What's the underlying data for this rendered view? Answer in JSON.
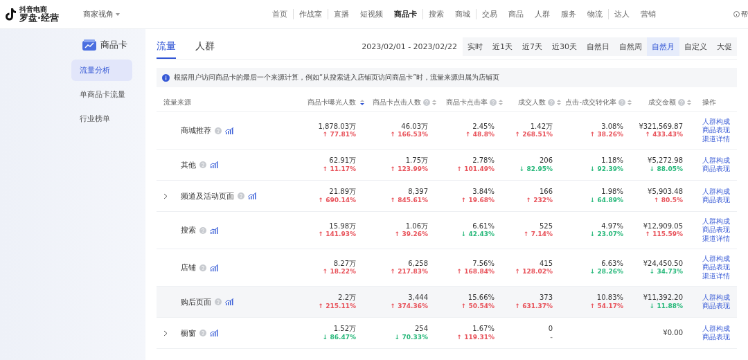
{
  "topbar": {
    "logo_small": "抖音电商",
    "logo_main": "罗盘·经营",
    "perspective": "商家视角",
    "nav": [
      {
        "label": "首页",
        "selected": false
      },
      {
        "label": "作战室",
        "selected": false
      },
      {
        "label": "直播",
        "selected": false
      },
      {
        "label": "短视频",
        "selected": false
      },
      {
        "label": "商品卡",
        "selected": true
      },
      {
        "label": "搜索",
        "selected": false
      },
      {
        "label": "商城",
        "selected": false
      },
      {
        "label": "交易",
        "selected": false
      },
      {
        "label": "商品",
        "selected": false
      },
      {
        "label": "人群",
        "selected": false
      },
      {
        "label": "服务",
        "selected": false
      },
      {
        "label": "物流",
        "selected": false
      },
      {
        "label": "达人",
        "selected": false
      },
      {
        "label": "营销",
        "selected": false
      }
    ],
    "help": "帮"
  },
  "sidebar": {
    "title": "商品卡",
    "items": [
      {
        "label": "流量分析",
        "selected": true
      },
      {
        "label": "单商品卡流量",
        "selected": false
      },
      {
        "label": "行业榜单",
        "selected": false
      }
    ]
  },
  "tabs": [
    {
      "label": "流量",
      "selected": true
    },
    {
      "label": "人群",
      "selected": false
    }
  ],
  "date_range": "2023/02/01 - 2023/02/22",
  "periods": [
    {
      "label": "实时",
      "selected": false
    },
    {
      "label": "近1天",
      "selected": false
    },
    {
      "label": "近7天",
      "selected": false
    },
    {
      "label": "近30天",
      "selected": false
    },
    {
      "label": "自然日",
      "selected": false
    },
    {
      "label": "自然周",
      "selected": false
    },
    {
      "label": "自然月",
      "selected": true
    },
    {
      "label": "自定义",
      "selected": false
    },
    {
      "label": "大促",
      "selected": false
    }
  ],
  "notice": "根据用户访问商品卡的最后一个来源计算，例如“从搜索进入店铺页访问商品卡”时，流量来源归属为店铺页",
  "table": {
    "source_header": "流量来源",
    "actions_header": "操作",
    "columns": [
      {
        "label": "商品卡曝光人数",
        "sort_active": true
      },
      {
        "label": "商品卡点击人数",
        "sort_active": false
      },
      {
        "label": "商品卡点击率",
        "sort_active": false
      },
      {
        "label": "成交人数",
        "sort_active": false
      },
      {
        "label": "点击-成交转化率",
        "sort_active": false
      },
      {
        "label": "成交金额",
        "sort_active": false
      }
    ],
    "rows": [
      {
        "source": "商城推荐",
        "expandable": false,
        "highlighted": false,
        "cells": [
          {
            "value": "1,878.03万",
            "change": "↑ 77.81%",
            "color": "#e8525a"
          },
          {
            "value": "46.03万",
            "change": "↑ 166.53%",
            "color": "#e8525a"
          },
          {
            "value": "2.45%",
            "change": "↑ 48.8%",
            "color": "#e8525a"
          },
          {
            "value": "1.42万",
            "change": "↑ 268.51%",
            "color": "#e8525a"
          },
          {
            "value": "3.08%",
            "change": "↑ 38.26%",
            "color": "#e8525a"
          },
          {
            "value": "¥321,569.87",
            "change": "↑ 433.43%",
            "color": "#e8525a"
          }
        ],
        "actions": [
          "人群构成",
          "商品表现",
          "渠道详情"
        ]
      },
      {
        "source": "其他",
        "expandable": false,
        "highlighted": false,
        "cells": [
          {
            "value": "62.91万",
            "change": "↑ 11.17%",
            "color": "#e8525a"
          },
          {
            "value": "1.75万",
            "change": "↑ 123.99%",
            "color": "#e8525a"
          },
          {
            "value": "2.78%",
            "change": "↑ 101.49%",
            "color": "#e8525a"
          },
          {
            "value": "206",
            "change": "↓ 82.95%",
            "color": "#27b87a"
          },
          {
            "value": "1.18%",
            "change": "↓ 92.39%",
            "color": "#27b87a"
          },
          {
            "value": "¥5,272.98",
            "change": "↓ 88.05%",
            "color": "#27b87a"
          }
        ],
        "actions": [
          "人群构成",
          "商品表现"
        ]
      },
      {
        "source": "频道及活动页面",
        "expandable": true,
        "highlighted": false,
        "cells": [
          {
            "value": "21.89万",
            "change": "↑ 690.14%",
            "color": "#e8525a"
          },
          {
            "value": "8,397",
            "change": "↑ 845.61%",
            "color": "#e8525a"
          },
          {
            "value": "3.84%",
            "change": "↑ 19.68%",
            "color": "#e8525a"
          },
          {
            "value": "166",
            "change": "↑ 232%",
            "color": "#e8525a"
          },
          {
            "value": "1.98%",
            "change": "↓ 64.89%",
            "color": "#27b87a"
          },
          {
            "value": "¥5,903.48",
            "change": "↑ 80.5%",
            "color": "#e8525a"
          }
        ],
        "actions": [
          "人群构成",
          "商品表现"
        ]
      },
      {
        "source": "搜索",
        "expandable": false,
        "highlighted": false,
        "cells": [
          {
            "value": "15.98万",
            "change": "↑ 141.93%",
            "color": "#e8525a"
          },
          {
            "value": "1.06万",
            "change": "↑ 39.26%",
            "color": "#e8525a"
          },
          {
            "value": "6.61%",
            "change": "↓ 42.43%",
            "color": "#27b87a"
          },
          {
            "value": "525",
            "change": "↑ 7.14%",
            "color": "#e8525a"
          },
          {
            "value": "4.97%",
            "change": "↓ 23.07%",
            "color": "#27b87a"
          },
          {
            "value": "¥12,909.05",
            "change": "↑ 115.59%",
            "color": "#e8525a"
          }
        ],
        "actions": [
          "人群构成",
          "商品表现",
          "渠道详情"
        ]
      },
      {
        "source": "店铺",
        "expandable": false,
        "highlighted": false,
        "cells": [
          {
            "value": "8.27万",
            "change": "↑ 18.22%",
            "color": "#e8525a"
          },
          {
            "value": "6,258",
            "change": "↑ 217.83%",
            "color": "#e8525a"
          },
          {
            "value": "7.56%",
            "change": "↑ 168.84%",
            "color": "#e8525a"
          },
          {
            "value": "415",
            "change": "↑ 128.02%",
            "color": "#e8525a"
          },
          {
            "value": "6.63%",
            "change": "↓ 28.26%",
            "color": "#27b87a"
          },
          {
            "value": "¥24,450.50",
            "change": "↓ 34.73%",
            "color": "#27b87a"
          }
        ],
        "actions": [
          "人群构成",
          "商品表现",
          "渠道详情"
        ]
      },
      {
        "source": "购后页面",
        "expandable": false,
        "highlighted": true,
        "cells": [
          {
            "value": "2.2万",
            "change": "↑ 215.11%",
            "color": "#e8525a"
          },
          {
            "value": "3,444",
            "change": "↑ 374.36%",
            "color": "#e8525a"
          },
          {
            "value": "15.66%",
            "change": "↑ 50.54%",
            "color": "#e8525a"
          },
          {
            "value": "373",
            "change": "↑ 631.37%",
            "color": "#e8525a"
          },
          {
            "value": "10.83%",
            "change": "↑ 54.17%",
            "color": "#e8525a"
          },
          {
            "value": "¥11,392.20",
            "change": "↓ 11.88%",
            "color": "#27b87a"
          }
        ],
        "actions": [
          "人群构成",
          "商品表现"
        ]
      },
      {
        "source": "橱窗",
        "expandable": true,
        "highlighted": false,
        "cells": [
          {
            "value": "1.52万",
            "change": "↓ 86.47%",
            "color": "#27b87a"
          },
          {
            "value": "254",
            "change": "↓ 70.33%",
            "color": "#27b87a"
          },
          {
            "value": "1.67%",
            "change": "↑ 119.31%",
            "color": "#e8525a"
          },
          {
            "value": "0",
            "change": "-"
          },
          null,
          {
            "value": "¥0.00"
          }
        ],
        "actions": [
          "人群构成",
          "商品表现"
        ]
      }
    ]
  }
}
